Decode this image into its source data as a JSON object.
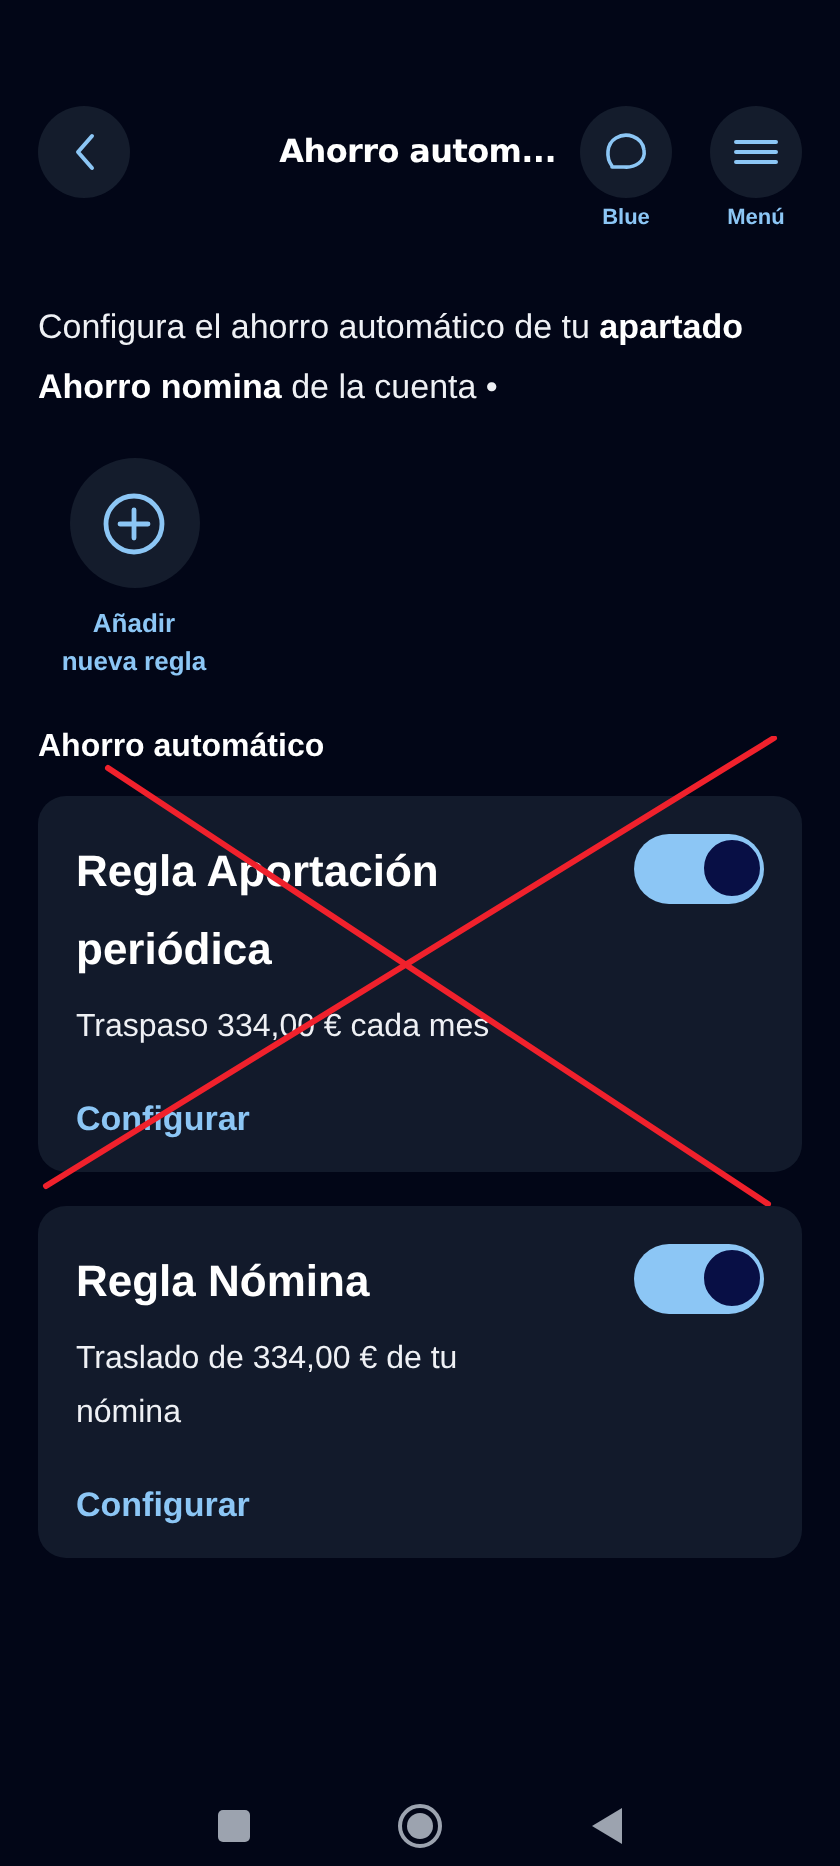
{
  "header": {
    "title": "Ahorro autom...",
    "actions": [
      {
        "kind": "chat",
        "label": "Blue"
      },
      {
        "kind": "menu",
        "label": "Menú"
      }
    ]
  },
  "intro": "Configura el ahorro automático de tu **apartado Ahorro nomina** de la cuenta •",
  "add_rule": {
    "label": "Añadir nueva regla"
  },
  "section_title": "Ahorro automático",
  "rules": [
    {
      "title": "Regla Aportación periódica",
      "description": "Traspaso 334,00 € cada mes",
      "on": true,
      "link": "Configurar",
      "crossed_out": true
    },
    {
      "title": "Regla Nómina",
      "description": "Traslado de 334,00 € de tu nómina",
      "on": true,
      "link": "Configurar",
      "crossed_out": false
    }
  ]
}
